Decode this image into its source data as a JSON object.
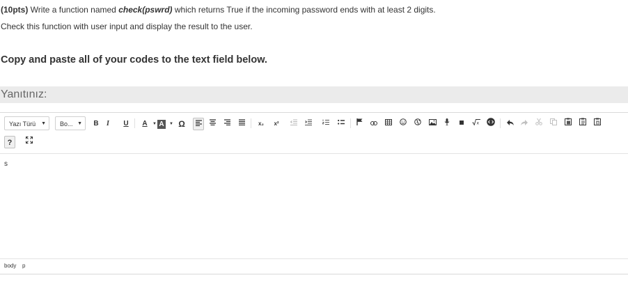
{
  "question": {
    "points": "(10pts)",
    "text_a": " Write a function named ",
    "function_name": "check(pswrd)",
    "text_b": " which returns True if the incoming password ends with at least 2 digits.",
    "line2": "Check this function with user input and display the result to the user.",
    "instruction": "Copy and paste all of your codes to the text field below."
  },
  "answer_label": "Yanıtınız:",
  "toolbar": {
    "font_family": "Yazı Türü",
    "font_size": "Bo...",
    "bold": "B",
    "italic": "I",
    "underline": "U",
    "text_color": "A",
    "bg_color": "A",
    "special_char": "Ω",
    "subscript": "x₂",
    "superscript": "x²",
    "help": "?"
  },
  "icons": [
    "chevron-down-icon",
    "align-left-icon",
    "align-center-icon",
    "align-right-icon",
    "align-justify-icon",
    "outdent-icon",
    "indent-icon",
    "numbered-list-icon",
    "bulleted-list-icon",
    "flag-icon",
    "link-icon",
    "table-icon",
    "emoji-icon",
    "globe-icon",
    "image-icon",
    "microphone-icon",
    "video-icon",
    "math-icon",
    "code-icon",
    "undo-icon",
    "redo-icon",
    "cut-icon",
    "copy-icon",
    "paste-icon",
    "paste-text-icon",
    "paste-word-icon",
    "fullscreen-icon"
  ],
  "editor_content": "s",
  "status_path": {
    "body": "body",
    "p": "p"
  }
}
